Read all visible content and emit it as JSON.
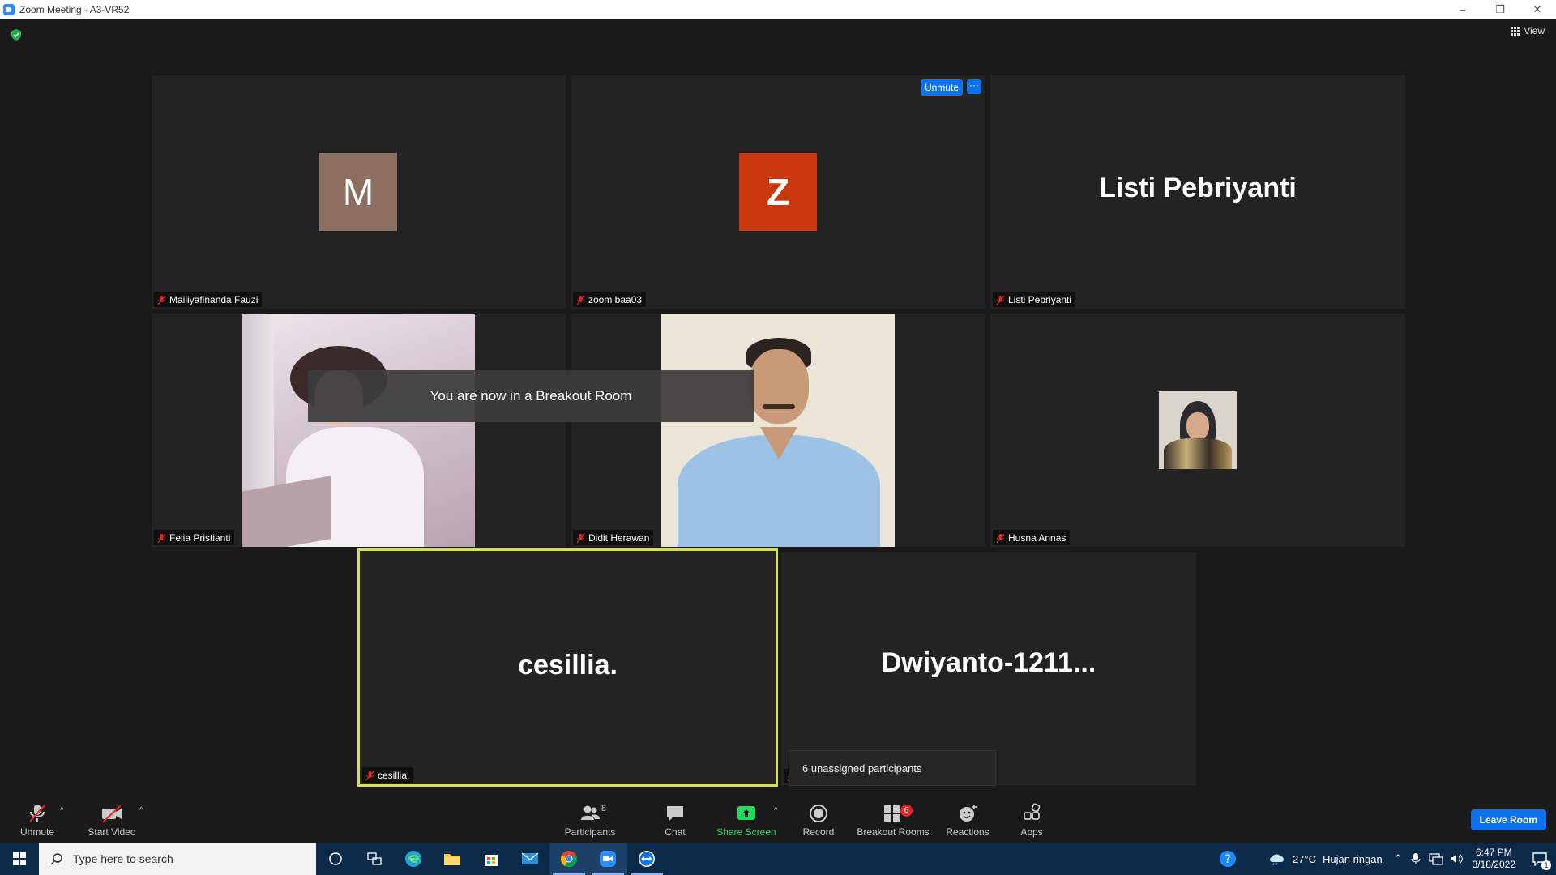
{
  "window": {
    "title": "Zoom Meeting - A3-VR52",
    "min": "–",
    "restore": "❐",
    "close": "✕"
  },
  "view_button": {
    "label": "View"
  },
  "tiles": [
    {
      "name": "Mailiyafinanda Fauzi",
      "avatar_letter": "M",
      "avatar_color": "#8c6e61"
    },
    {
      "name": "zoom baa03",
      "avatar_letter": "Z",
      "avatar_color": "#c8380c",
      "unmute_label": "Unmute",
      "more_label": "···"
    },
    {
      "name": "Listi Pebriyanti",
      "display_name": "Listi Pebriyanti"
    },
    {
      "name": "Felia Pristianti"
    },
    {
      "name": "Didit Herawan"
    },
    {
      "name": "Husna Annas"
    },
    {
      "name": "cesillia.",
      "display_name": "cesillia."
    },
    {
      "display_name": "Dwiyanto-1211..."
    }
  ],
  "toast": "You are now in a Breakout Room",
  "tooltip": "6 unassigned participants",
  "toolbar": {
    "unmute": "Unmute",
    "start_video": "Start Video",
    "participants": "Participants",
    "participants_count": "8",
    "chat": "Chat",
    "share_screen": "Share Screen",
    "record": "Record",
    "breakout_rooms": "Breakout Rooms",
    "breakout_badge": "6",
    "reactions": "Reactions",
    "apps": "Apps",
    "leave_room": "Leave Room",
    "caret": "^"
  },
  "taskbar": {
    "search_placeholder": "Type here to search",
    "weather_temp": "27°C",
    "weather_desc": "Hujan ringan",
    "time": "6:47 PM",
    "date": "3/18/2022",
    "notification_count": "1"
  },
  "colors": {
    "accent": "#0e72ed",
    "active_speaker_border": "#d4e157",
    "share_green": "#23d959"
  }
}
